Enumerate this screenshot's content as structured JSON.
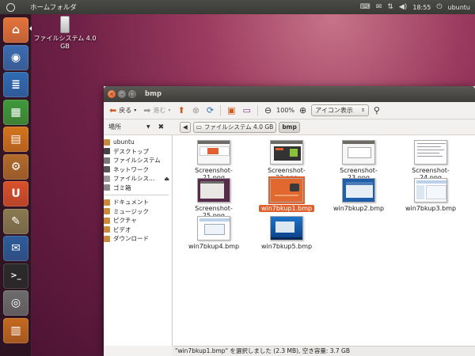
{
  "top_panel": {
    "title": "ホームフォルダ",
    "time": "18:55",
    "user": "ubuntu"
  },
  "desktop_icon": {
    "label": "ファイルシステム 4.0 GB"
  },
  "launcher": [
    {
      "name": "home-folder",
      "color": "#e4733a",
      "glyph": "⌂"
    },
    {
      "name": "firefox",
      "color": "#3a6db0",
      "glyph": "◉"
    },
    {
      "name": "writer",
      "color": "#2f6bb3",
      "glyph": "≣"
    },
    {
      "name": "calc",
      "color": "#3f9a3a",
      "glyph": "▦"
    },
    {
      "name": "impress",
      "color": "#d4741c",
      "glyph": "▤"
    },
    {
      "name": "software-center",
      "color": "#b26b2a",
      "glyph": "⚙"
    },
    {
      "name": "ubuntu-one",
      "color": "#d8502a",
      "glyph": "U"
    },
    {
      "name": "gimp",
      "color": "#8a7a50",
      "glyph": "✎"
    },
    {
      "name": "thunderbird",
      "color": "#2d5c9a",
      "glyph": "✉"
    },
    {
      "name": "terminal",
      "color": "#2b2b2b",
      "glyph": ">_"
    },
    {
      "name": "camera",
      "color": "#6d6d6d",
      "glyph": "◎"
    },
    {
      "name": "workspaces",
      "color": "#c4691f",
      "glyph": "▥"
    }
  ],
  "window": {
    "title": "bmp",
    "toolbar": {
      "back": "戻る",
      "forward": "進む",
      "zoom": "100%",
      "view": "アイコン表示"
    },
    "sidebar_header": "場所",
    "breadcrumbs": [
      "ファイルシステム 4.0 GB",
      "bmp"
    ],
    "sidebar_items": [
      {
        "label": "ubuntu",
        "color": "#c98a3a",
        "eject": false
      },
      {
        "label": "デスクトップ",
        "color": "#444444",
        "eject": false
      },
      {
        "label": "ファイルシステム",
        "color": "#777777",
        "eject": false
      },
      {
        "label": "ネットワーク",
        "color": "#555555",
        "eject": false
      },
      {
        "label": "ファイルシス...",
        "color": "#999999",
        "eject": true
      },
      {
        "label": "ゴミ箱",
        "color": "#888888",
        "eject": false
      },
      {
        "label": "ドキュメント",
        "color": "#c98a3a",
        "eject": false
      },
      {
        "label": "ミュージック",
        "color": "#c98a3a",
        "eject": false
      },
      {
        "label": "ピクチャ",
        "color": "#c98a3a",
        "eject": false
      },
      {
        "label": "ビデオ",
        "color": "#c98a3a",
        "eject": false
      },
      {
        "label": "ダウンロード",
        "color": "#c98a3a",
        "eject": false
      }
    ],
    "files": [
      {
        "name": "Screenshot-21.png",
        "style": "light",
        "selected": false
      },
      {
        "name": "Screenshot-22.png",
        "style": "darkgreen",
        "selected": false
      },
      {
        "name": "Screenshot-23.png",
        "style": "white",
        "selected": false
      },
      {
        "name": "Screenshot-24.png",
        "style": "doc",
        "selected": false
      },
      {
        "name": "Screenshot-25.png",
        "style": "purple",
        "selected": false
      },
      {
        "name": "win7bkup1.bmp",
        "style": "orange",
        "selected": true
      },
      {
        "name": "win7bkup2.bmp",
        "style": "win7",
        "selected": false
      },
      {
        "name": "win7bkup3.bmp",
        "style": "win7light",
        "selected": false
      },
      {
        "name": "win7bkup4.bmp",
        "style": "win7dialog",
        "selected": false
      },
      {
        "name": "win7bkup5.bmp",
        "style": "win7desk",
        "selected": false
      }
    ],
    "status": "\"win7bkup1.bmp\" を選択しました (2.3 MB), 空き容量: 3.7 GB"
  }
}
